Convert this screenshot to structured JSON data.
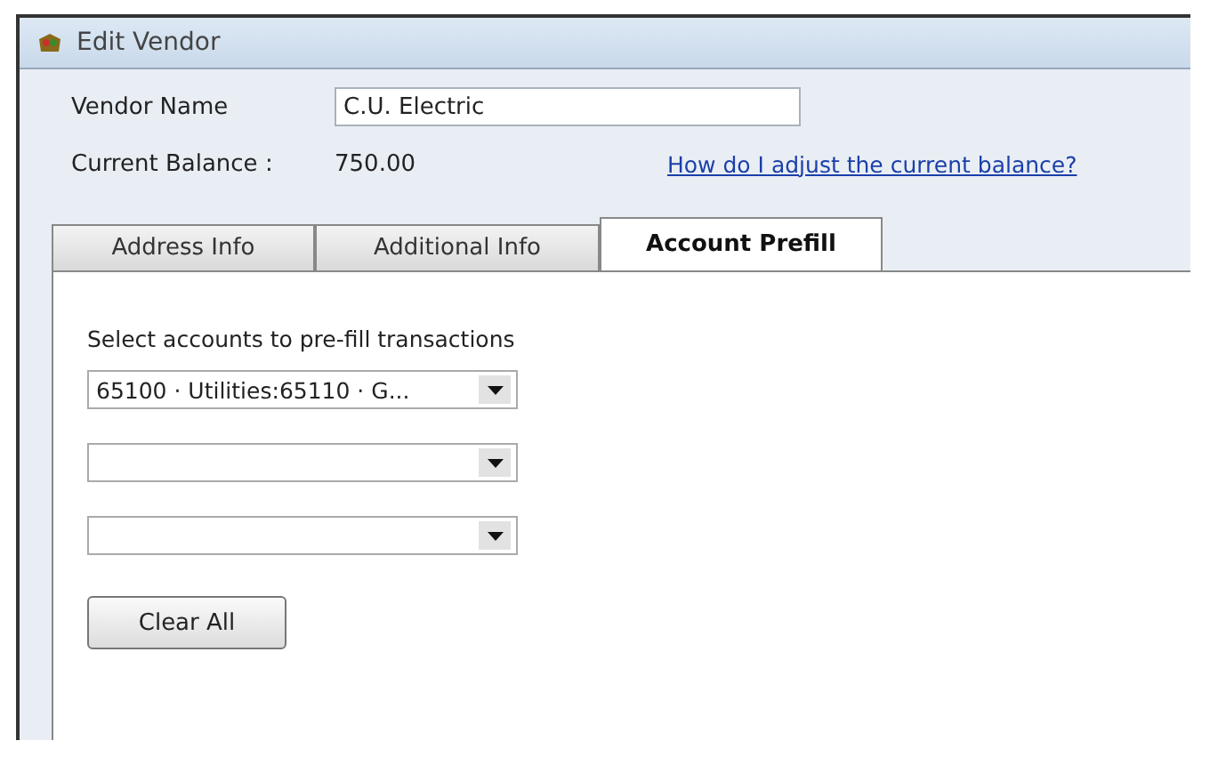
{
  "window": {
    "title": "Edit Vendor"
  },
  "vendor_name": {
    "label": "Vendor Name",
    "value": "C.U. Electric"
  },
  "current_balance": {
    "label": "Current Balance :",
    "value": "750.00",
    "link": "How do I adjust the current balance?"
  },
  "tabs": [
    {
      "label": "Address Info",
      "selected": false
    },
    {
      "label": "Additional Info",
      "selected": false
    },
    {
      "label": "Account Prefill",
      "selected": true
    }
  ],
  "prefill": {
    "instruction": "Select accounts to pre-fill transactions",
    "accounts": [
      {
        "kind": "filled",
        "value": "65100 · Utilities:65110 · G..."
      },
      {
        "kind": "empty"
      },
      {
        "kind": "empty"
      }
    ],
    "button": "Clear All"
  }
}
